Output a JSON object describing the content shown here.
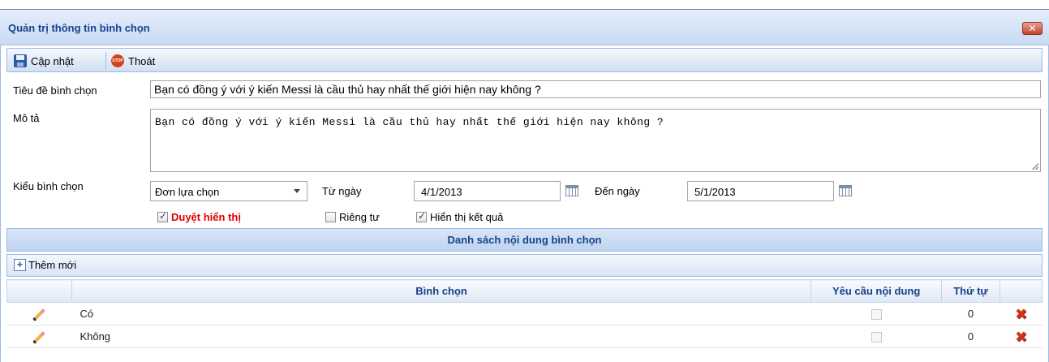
{
  "window": {
    "title": "Quản trị thông tin bình chọn",
    "close_glyph": "✕"
  },
  "toolbar": {
    "update_label": "Cập nhật",
    "exit_label": "Thoát",
    "exit_icon_text": "STOP"
  },
  "form": {
    "title_label": "Tiêu đề bình chọn",
    "title_value": "Bạn có đồng ý với ý kiến Messi là cầu thủ hay nhất thế giới hiện nay không ?",
    "description_label": "Mô tả",
    "description_value": "Bạn có đồng ý với ý kiến Messi là cầu thủ hay nhất thế giới hiện nay không ?",
    "type_label": "Kiểu bình chọn",
    "type_value": "Đơn lựa chọn",
    "from_label": "Từ ngày",
    "from_value": "4/1/2013",
    "to_label": "Đến ngày",
    "to_value": "5/1/2013",
    "approve_label": "Duyệt hiển thị",
    "approve_checked": true,
    "private_label": "Riêng tư",
    "private_checked": false,
    "show_result_label": "Hiển thị kết quả",
    "show_result_checked": true
  },
  "options_section": {
    "header": "Danh sách nội dung bình chọn",
    "add_label": "Thêm mới",
    "columns": [
      "Bình chọn",
      "Yêu cầu nội dung",
      "Thứ tự"
    ],
    "rows": [
      {
        "name": "Có",
        "order": "0",
        "require_content": false
      },
      {
        "name": "Không",
        "order": "0",
        "require_content": false
      }
    ]
  }
}
